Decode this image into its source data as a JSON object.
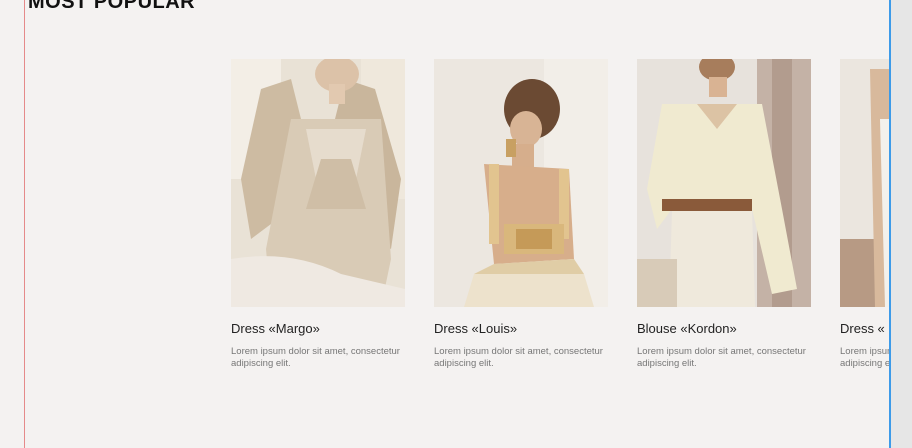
{
  "section": {
    "title": "MOST POPULAR"
  },
  "products": [
    {
      "title": "Dress «Margo»",
      "description": "Lorem ipsum dolor sit amet, consectetur adipiscing elit."
    },
    {
      "title": "Dress «Louis»",
      "description": "Lorem ipsum dolor sit amet, consectetur adipiscing elit."
    },
    {
      "title": "Blouse «Kordon»",
      "description": "Lorem ipsum dolor sit amet, consectetur adipiscing elit."
    },
    {
      "title": "Dress «",
      "description": "Lorem ipsum dolor sit amet, consectetur adipiscing elit."
    }
  ],
  "colors": {
    "background": "#f4f2f1",
    "title_text": "#111111",
    "muted_text": "#777777",
    "guide_left": "#e58a8a",
    "guide_right": "#3d9be9"
  }
}
